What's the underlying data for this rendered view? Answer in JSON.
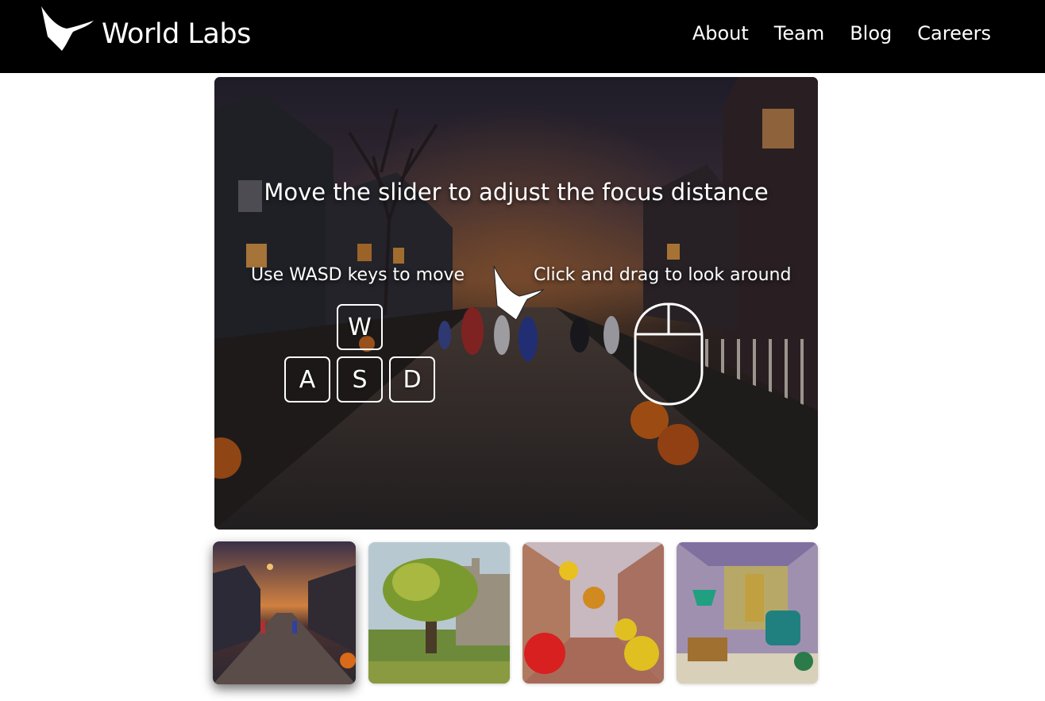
{
  "header": {
    "brand": "World Labs",
    "nav": [
      {
        "label": "About"
      },
      {
        "label": "Team"
      },
      {
        "label": "Blog"
      },
      {
        "label": "Careers"
      }
    ]
  },
  "viewer": {
    "focus_hint": "Move the slider to adjust the focus distance",
    "move_hint": "Use WASD keys to move",
    "look_hint": "Click and drag to look around",
    "keys": {
      "w": "W",
      "a": "A",
      "s": "S",
      "d": "D"
    },
    "icons": [
      "world-labs-logo-icon",
      "mouse-icon"
    ]
  },
  "gallery": {
    "selected_index": 0,
    "scenes": [
      {
        "icon": "halloween-street-scene"
      },
      {
        "icon": "tree-castle-scene"
      },
      {
        "icon": "polka-dot-alley-scene"
      },
      {
        "icon": "retro-room-scene"
      }
    ]
  }
}
